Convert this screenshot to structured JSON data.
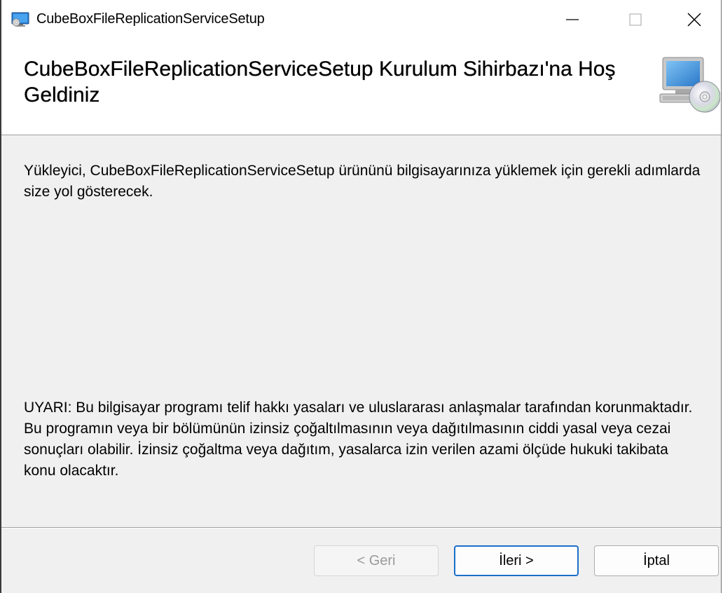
{
  "window": {
    "title": "CubeBoxFileReplicationServiceSetup",
    "app_icon": "installer-monitor-icon",
    "controls": {
      "minimize": "minimize-icon",
      "maximize": "maximize-icon",
      "close": "close-icon"
    }
  },
  "banner": {
    "title": "CubeBoxFileReplicationServiceSetup Kurulum Sihirbazı'na Hoş Geldiniz",
    "icon": "computer-cd-icon"
  },
  "body": {
    "intro": "Yükleyici, CubeBoxFileReplicationServiceSetup ürününü bilgisayarınıza yüklemek için gerekli adımlarda size yol gösterecek.",
    "warning": "UYARI: Bu bilgisayar programı telif hakkı yasaları ve uluslararası anlaşmalar tarafından korunmaktadır. Bu programın veya bir bölümünün izinsiz çoğaltılmasının veya dağıtılmasının ciddi yasal veya cezai sonuçları olabilir. İzinsiz çoğaltma veya dağıtım, yasalarca izin verilen azami ölçüde hukuki takibata konu olacaktır."
  },
  "buttons": {
    "back": "< Geri",
    "next": "İleri >",
    "cancel": "İptal"
  },
  "colors": {
    "accent": "#1a6fc9",
    "dialog_bg": "#f0f0f0",
    "banner_bg": "#ffffff",
    "disabled_text": "#9a9a9a"
  }
}
